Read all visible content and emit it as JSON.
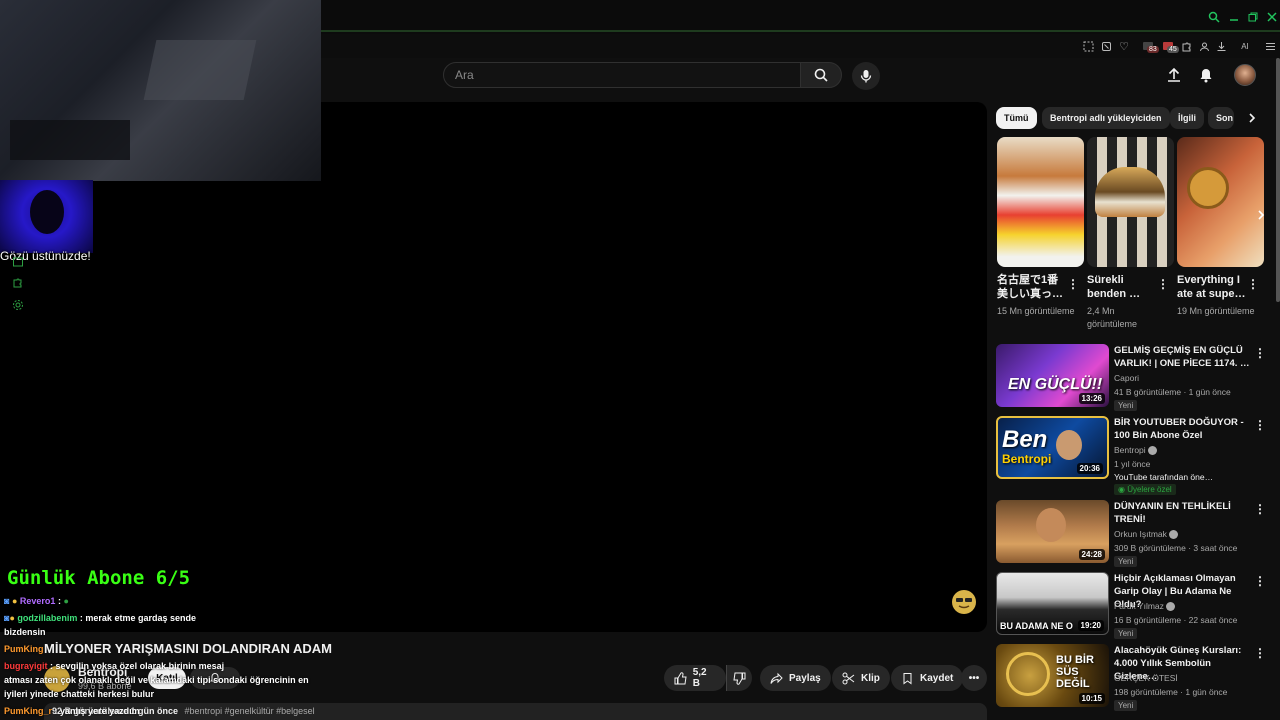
{
  "browser": {
    "ai_label": "AI",
    "tab_badges": [
      "83",
      "45"
    ]
  },
  "header": {
    "search_placeholder": "Ara"
  },
  "overlay": {
    "webcam_caption": "Gözü üstünüzde!",
    "goal_text": "Günlük Abone 6/5"
  },
  "chat": [
    {
      "user": "Revero1",
      "user_color": "#b06cff",
      "message": ":"
    },
    {
      "user": "godzillabenim",
      "user_color": "#3fe07a",
      "message": ": merak etme gardaş sende"
    },
    {
      "user": "",
      "user_color": "#ffffff",
      "message": "bizdensin"
    },
    {
      "user": "PumKing",
      "user_color": "#ff9a2e",
      "message": ""
    },
    {
      "user": "bugrayigit",
      "user_color": "#ff3b3b",
      "message": ": sevgilin yoksa özel olarak birinin mesaj"
    },
    {
      "user": "",
      "user_color": "#ffffff",
      "message": "atması zaten çok olanaklı değil ve kafamdaki tipi sondaki öğrencinin en"
    },
    {
      "user": "",
      "user_color": "#ffffff",
      "message": "iyileri yinede chatteki herkesi bulur"
    },
    {
      "user": "PumKing_r",
      "user_color": "#ff9a2e",
      "message": ": yanlış yere yazdım"
    }
  ],
  "video": {
    "title": "MİLYONER YARIŞMASINI DOLANDIRAN ADAM",
    "channel": "Bentropi",
    "subscribers": "99,6 B abone",
    "join_label": "Katıl",
    "likes": "5,2 B",
    "share_label": "Paylaş",
    "clip_label": "Klip",
    "save_label": "Kaydet",
    "views_date": "92 B görüntüleme  1 gün önce",
    "tags": "#bentropi #genelkültür #belgesel"
  },
  "chips": [
    {
      "label": "Tümü",
      "active": true
    },
    {
      "label": "Bentropi adlı yükleyiciden",
      "active": false
    },
    {
      "label": "İlgili",
      "active": false
    },
    {
      "label": "Son",
      "active": false
    }
  ],
  "shorts": [
    {
      "title": "名古屋で1番美しい真っ…",
      "views": "15 Mn görüntüleme"
    },
    {
      "title": "Sürekli benden …",
      "views": "2,4 Mn görüntüleme"
    },
    {
      "title": "Everything I ate at supe…",
      "views": "19 Mn görüntüleme"
    }
  ],
  "recommendations": [
    {
      "title": "GELMİŞ GEÇMİŞ EN GÜÇLÜ VARLIK! | ONE PİECE 1174. …",
      "channel": "Capori",
      "meta": "41 B görüntüleme · 1 gün önce",
      "badge": "Yeni",
      "duration": "13:26",
      "thumb_text": "EN GÜÇLÜ!!"
    },
    {
      "title": "BİR YOUTUBER DOĞUYOR - 100 Bin Abone Özel",
      "channel": "Bentropi",
      "meta": "1 yıl önce",
      "extra": "YouTube tarafından öne…",
      "badge": "Üyelere özel",
      "duration": "20:36",
      "thumb_text": "Bentropi"
    },
    {
      "title": "DÜNYANIN EN TEHLİKELİ TRENİ!",
      "channel": "Orkun Işıtmak",
      "meta": "309 B görüntüleme · 3 saat önce",
      "badge": "Yeni",
      "duration": "24:28",
      "thumb_text": ""
    },
    {
      "title": "Hiçbir Açıklaması Olmayan Garip Olay | Bu Adama Ne Oldu?",
      "channel": "Faruk Yılmaz",
      "meta": "16 B görüntüleme · 22 saat önce",
      "badge": "Yeni",
      "duration": "19:20",
      "thumb_text": "BU ADAMA NE O"
    },
    {
      "title": "Alacahöyük Güneş Kursları: 4.000 Yıllık Sembolün Gizlene…",
      "channel": "GERÇEK ÖTESİ",
      "meta": "198 görüntüleme · 1 gün önce",
      "badge": "Yeni",
      "duration": "10:15",
      "thumb_text": "BU BİR SÜS DEĞİL"
    }
  ],
  "colors": {
    "accent_green": "#39ff14",
    "members_green": "#2ba640",
    "browser_accent": "#22c55e"
  }
}
